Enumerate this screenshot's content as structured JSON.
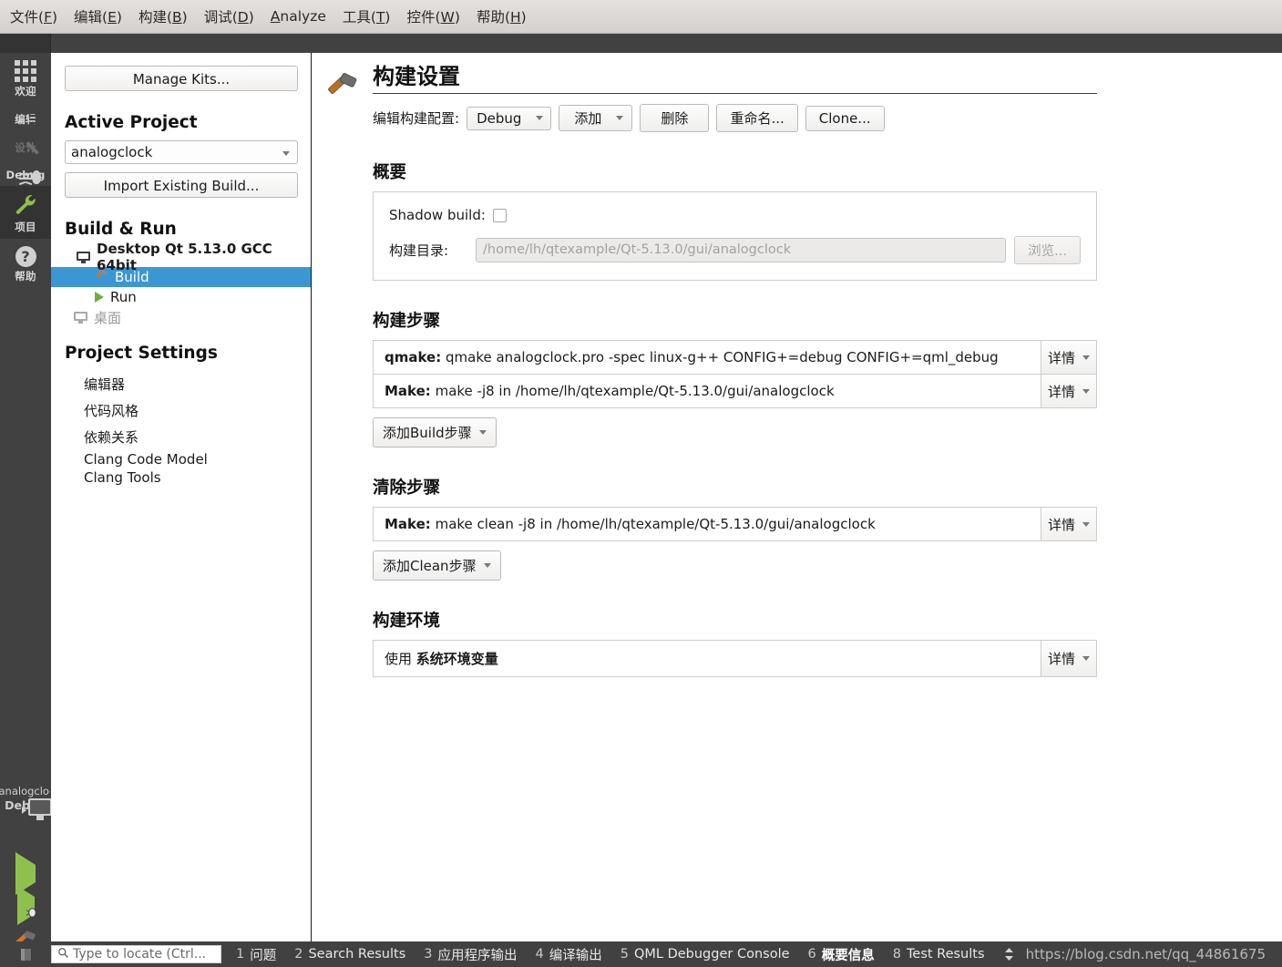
{
  "menu": {
    "items": [
      {
        "label": "文件(F)",
        "accel": "F"
      },
      {
        "label": "编辑(E)",
        "accel": "E"
      },
      {
        "label": "构建(B)",
        "accel": "B"
      },
      {
        "label": "调试(D)",
        "accel": "D"
      },
      {
        "label": "Analyze",
        "accel": "A"
      },
      {
        "label": "工具(T)",
        "accel": "T"
      },
      {
        "label": "控件(W)",
        "accel": "W"
      },
      {
        "label": "帮助(H)",
        "accel": "H"
      }
    ]
  },
  "modebar": {
    "items": [
      {
        "label": "欢迎",
        "icon": "grid-icon",
        "state": "normal"
      },
      {
        "label": "编辑",
        "icon": "edit-icon",
        "state": "normal"
      },
      {
        "label": "设计",
        "icon": "design-pencil-icon",
        "state": "disabled"
      },
      {
        "label": "Debug",
        "icon": "bug-icon",
        "state": "normal"
      },
      {
        "label": "项目",
        "icon": "wrench-icon",
        "state": "selected"
      },
      {
        "label": "帮助",
        "icon": "help-question-icon",
        "state": "normal"
      }
    ],
    "kit_selector": {
      "project": "analogclock",
      "build_config": "Debug",
      "icon": "monitor-icon"
    },
    "run_buttons": [
      {
        "name": "run-button",
        "icon": "play-triangle-icon"
      },
      {
        "name": "debug-button",
        "icon": "play-with-bug-icon"
      },
      {
        "name": "build-button",
        "icon": "hammer-icon"
      }
    ]
  },
  "leftpanel": {
    "manage_kits": "Manage Kits...",
    "active_project_title": "Active Project",
    "active_project_value": "analogclock",
    "import_existing_build": "Import Existing Build...",
    "build_run_title": "Build & Run",
    "tree": [
      {
        "label": "Desktop Qt 5.13.0 GCC 64bit",
        "kind": "kit",
        "icon": "monitor-icon"
      },
      {
        "label": "Build",
        "kind": "child",
        "icon": "hammer-icon",
        "selected": true
      },
      {
        "label": "Run",
        "kind": "child",
        "icon": "play-triangle-icon",
        "selected": false
      },
      {
        "label": "桌面",
        "kind": "kit-dim",
        "icon": "monitor-disabled-icon"
      }
    ],
    "project_settings_title": "Project Settings",
    "settings": [
      "编辑器",
      "代码风格",
      "依赖关系",
      "Clang Code Model",
      "Clang Tools"
    ]
  },
  "main": {
    "page_title": "构建设置",
    "title_icon": "hammer-icon",
    "toolbar": {
      "edit_config_label": "编辑构建配置:",
      "config_value": "Debug",
      "add_label": "添加",
      "remove_label": "删除",
      "rename_label": "重命名...",
      "clone_label": "Clone..."
    },
    "summary": {
      "heading": "概要",
      "shadow_build_label": "Shadow build:",
      "shadow_build_checked": false,
      "build_dir_label": "构建目录:",
      "build_dir_value": "/home/lh/qtexample/Qt-5.13.0/gui/analogclock",
      "browse_label": "浏览..."
    },
    "build_steps": {
      "heading": "构建步骤",
      "steps": [
        {
          "name": "qmake:",
          "command": "qmake analogclock.pro -spec linux-g++ CONFIG+=debug CONFIG+=qml_debug",
          "details_label": "详情"
        },
        {
          "name": "Make:",
          "command": "make -j8 in /home/lh/qtexample/Qt-5.13.0/gui/analogclock",
          "details_label": "详情"
        }
      ],
      "add_label": "添加Build步骤"
    },
    "clean_steps": {
      "heading": "清除步骤",
      "steps": [
        {
          "name": "Make:",
          "command": "make clean -j8 in /home/lh/qtexample/Qt-5.13.0/gui/analogclock",
          "details_label": "详情"
        }
      ],
      "add_label": "添加Clean步骤"
    },
    "build_env": {
      "heading": "构建环境",
      "use_label": "使用",
      "value_label": "系统环境变量",
      "details_label": "详情"
    }
  },
  "statusbar": {
    "locate_placeholder": "Type to locate (Ctrl...",
    "search_icon": "search-icon",
    "panes": [
      {
        "num": "1",
        "name": "问题",
        "active": false
      },
      {
        "num": "2",
        "name": "Search Results",
        "active": false
      },
      {
        "num": "3",
        "name": "应用程序输出",
        "active": false
      },
      {
        "num": "4",
        "name": "编译输出",
        "active": false
      },
      {
        "num": "5",
        "name": "QML Debugger Console",
        "active": false
      },
      {
        "num": "6",
        "name": "概要信息",
        "active": true
      },
      {
        "num": "8",
        "name": "Test Results",
        "active": false
      }
    ],
    "watermark": "https://blog.csdn.net/qq_44861675"
  },
  "colors": {
    "accent_blue": "#3a97d4",
    "dark_chrome": "#414141",
    "dark_selected": "#333333",
    "green": "#8fc04e"
  }
}
